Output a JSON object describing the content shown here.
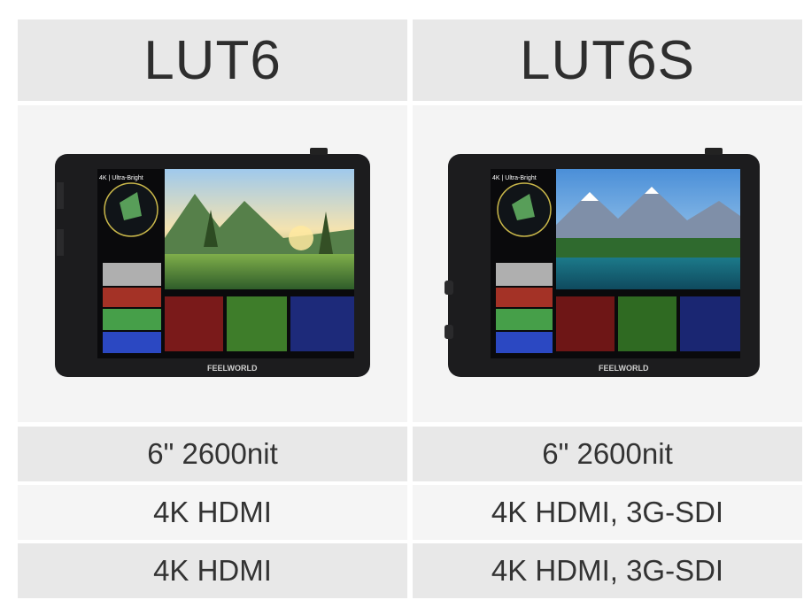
{
  "products": [
    {
      "name": "LUT6",
      "screen_badge": "4K | Ultra-Bright",
      "brand": "FEELWORLD",
      "specs": [
        "6\" 2600nit",
        "4K HDMI",
        "4K HDMI"
      ]
    },
    {
      "name": "LUT6S",
      "screen_badge": "4K | Ultra-Bright",
      "brand": "FEELWORLD",
      "specs": [
        "6\" 2600nit",
        "4K HDMI, 3G-SDI",
        "4K HDMI, 3G-SDI"
      ]
    }
  ],
  "colors": {
    "header_bg": "#e8e8e8",
    "row_gray": "#e8e8e8",
    "row_light": "#f5f5f5",
    "monitor_body": "#1c1c1e"
  }
}
